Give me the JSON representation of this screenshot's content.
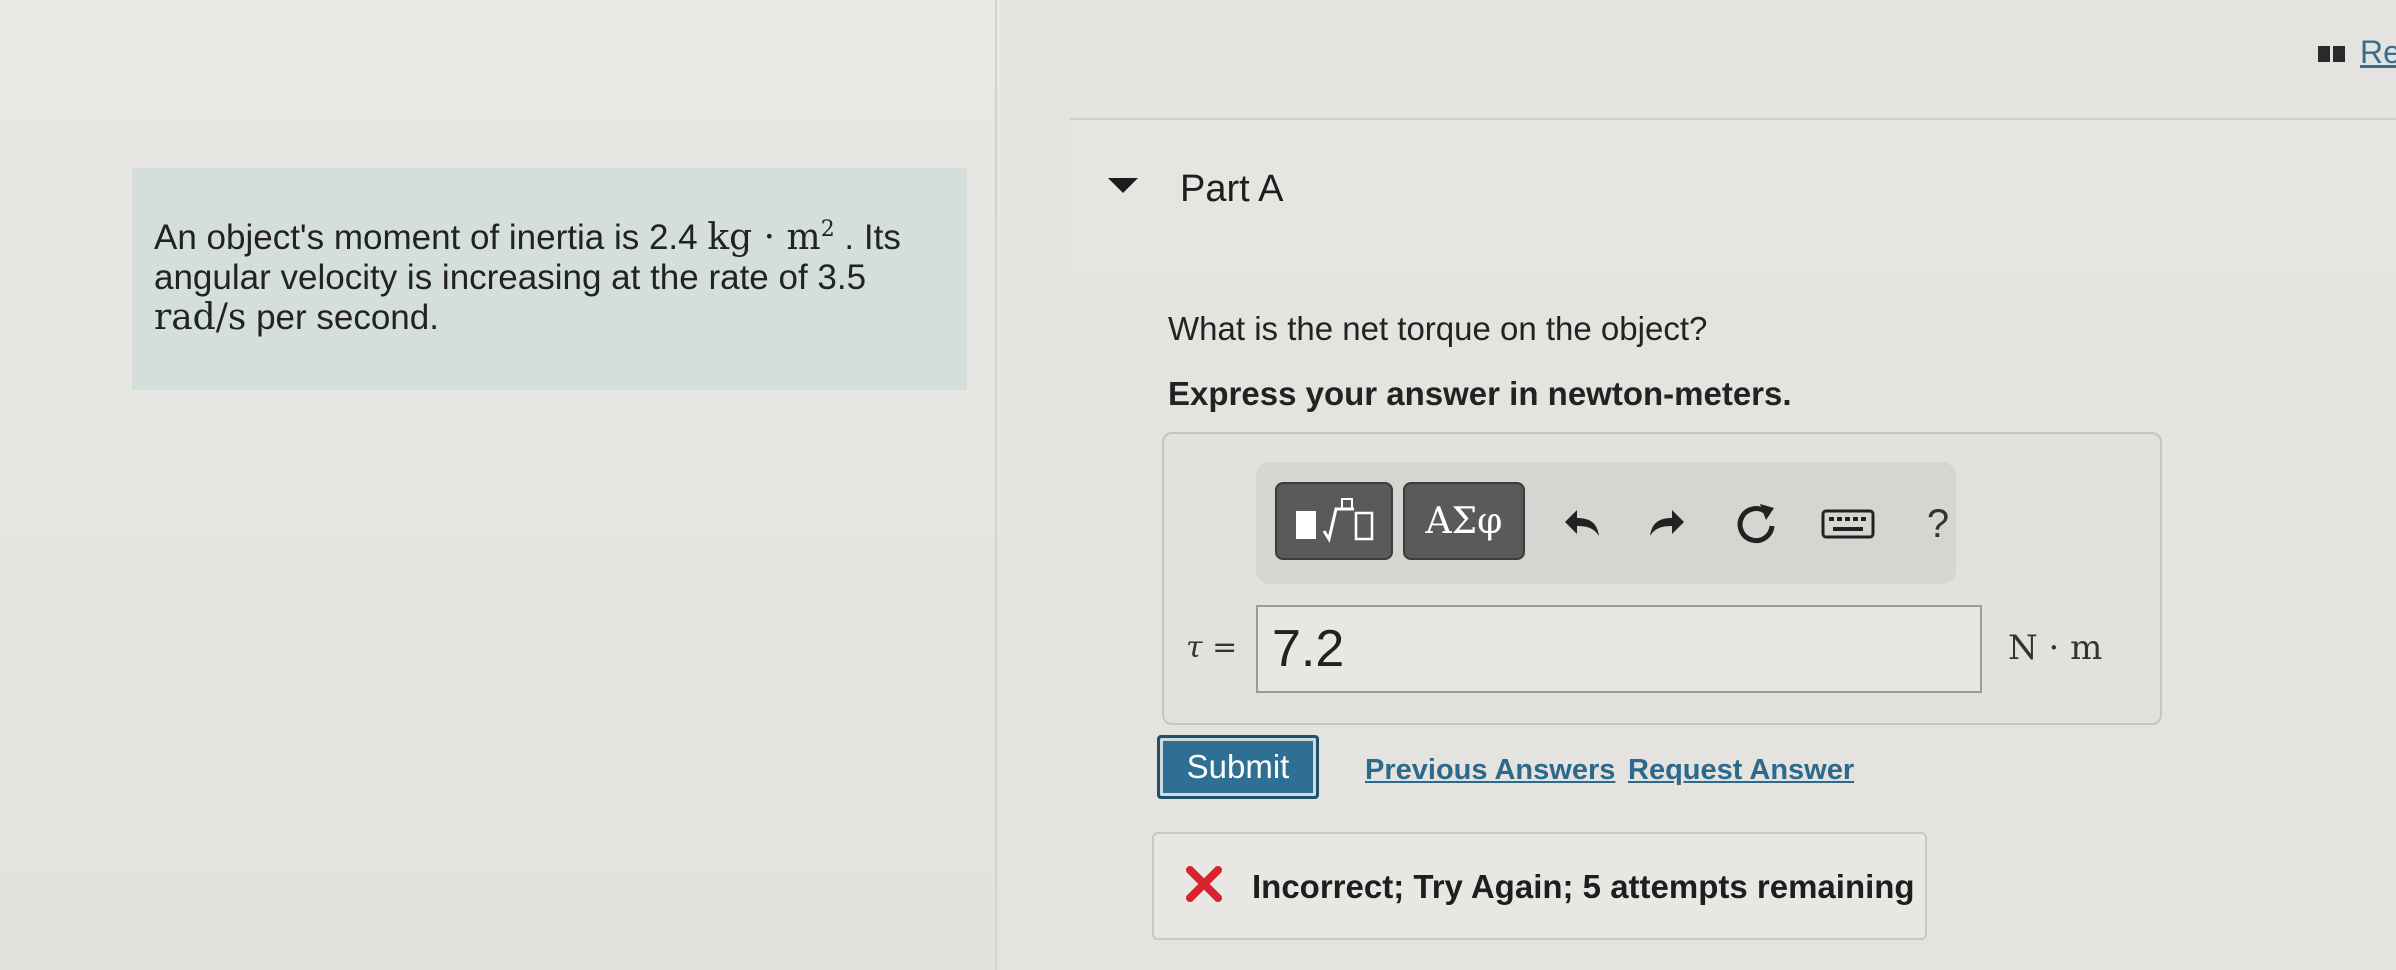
{
  "problem": {
    "text_1": "An object's moment of inertia is 2.4",
    "unit_1": "kg · m",
    "unit_1_exp": "2",
    "text_2": ". Its",
    "text_3": "angular velocity is increasing at the rate of 3.5",
    "unit_2": "rad/s",
    "text_4": "per second."
  },
  "header": {
    "link": "Re"
  },
  "part": {
    "title": "Part A"
  },
  "question": "What is the net torque on the object?",
  "instruction": "Express your answer in newton-meters.",
  "toolbar": {
    "greek_label": "ΑΣφ",
    "help_label": "?",
    "icons": [
      "templates-icon",
      "greek-symbols-icon",
      "undo-icon",
      "redo-icon",
      "reset-icon",
      "keyboard-icon",
      "help-icon"
    ]
  },
  "answer": {
    "variable": "τ =",
    "value": "7.2",
    "unit": "N · m"
  },
  "actions": {
    "submit": "Submit",
    "previous_answers": "Previous Answers",
    "request_answer": "Request Answer"
  },
  "feedback": {
    "text": "Incorrect; Try Again; 5 attempts remaining"
  },
  "colors": {
    "accent": "#2e6f93",
    "link": "#2b6a8c",
    "error": "#d9232e",
    "problem_bg": "#d4dfdb"
  }
}
